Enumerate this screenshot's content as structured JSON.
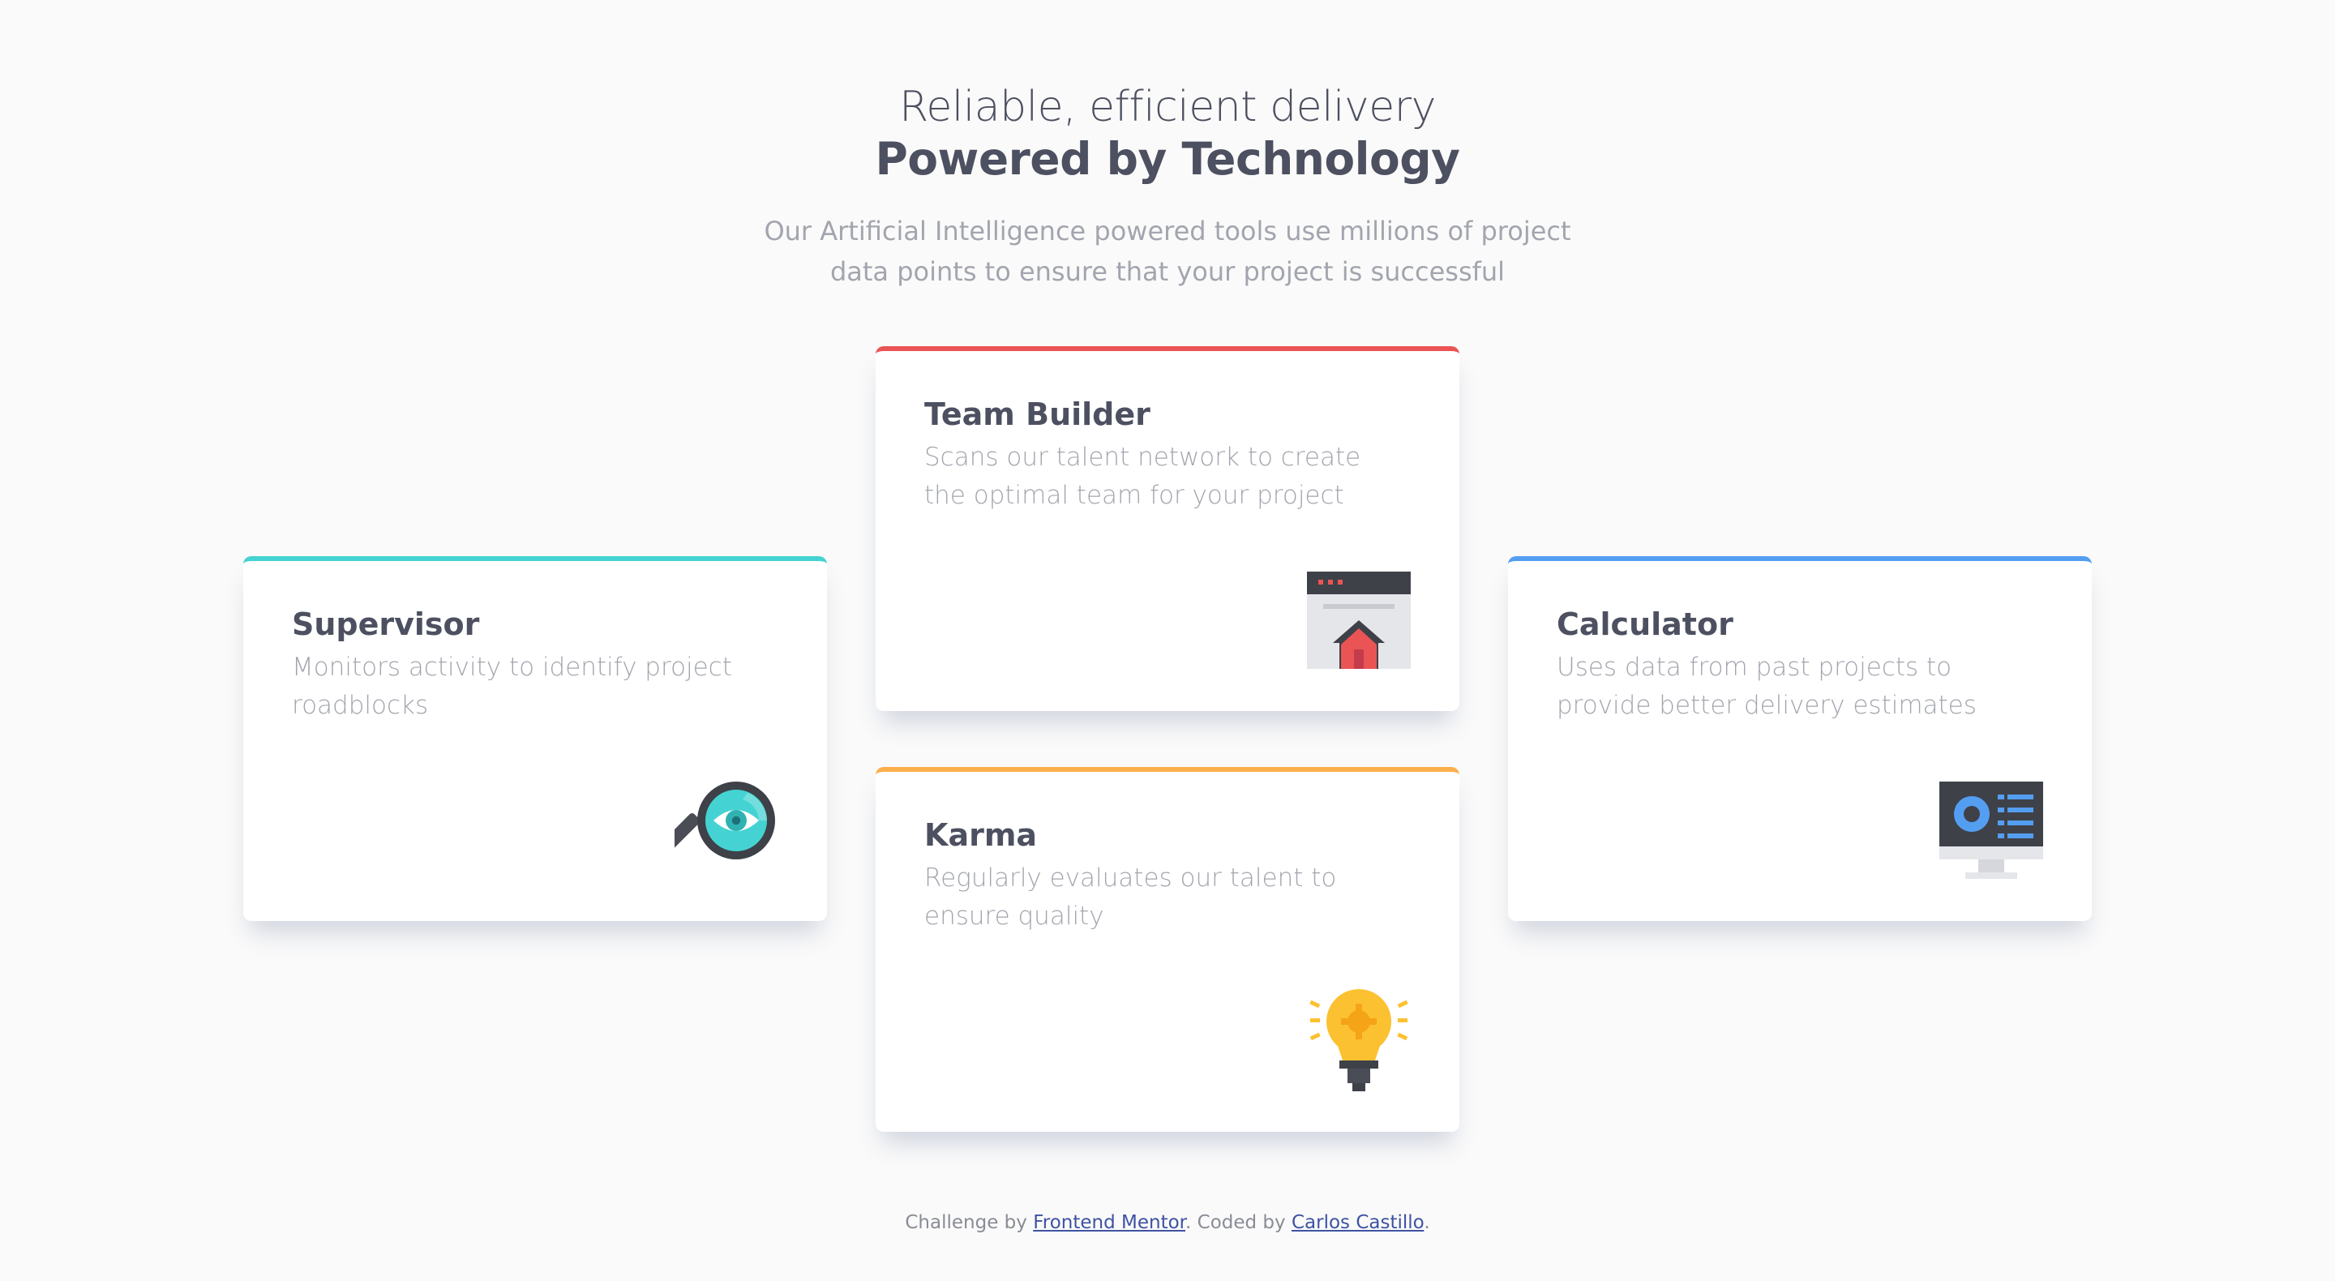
{
  "header": {
    "title_light": "Reliable, efficient delivery",
    "title_bold": "Powered by Technology",
    "subtitle": "Our Artificial Intelligence powered tools use millions of project data points to ensure that your project is successful"
  },
  "cards": [
    {
      "title": "Supervisor",
      "description": "Monitors activity to identify project roadblocks",
      "accent": "#44d3d2",
      "icon": "magnifier-eye-icon"
    },
    {
      "title": "Team Builder",
      "description": "Scans our talent network to create the optimal team for your project",
      "accent": "#ea5454",
      "icon": "browser-home-icon"
    },
    {
      "title": "Karma",
      "description": "Regularly evaluates our talent to ensure quality",
      "accent": "#fcaf4a",
      "icon": "lightbulb-icon"
    },
    {
      "title": "Calculator",
      "description": "Uses data from past projects to provide better delivery estimates",
      "accent": "#549ef2",
      "icon": "monitor-dashboard-icon"
    }
  ],
  "footer": {
    "prefix": "Challenge by ",
    "link1": "Frontend Mentor",
    "middle": ". Coded by ",
    "link2": "Carlos Castillo",
    "suffix": "."
  }
}
